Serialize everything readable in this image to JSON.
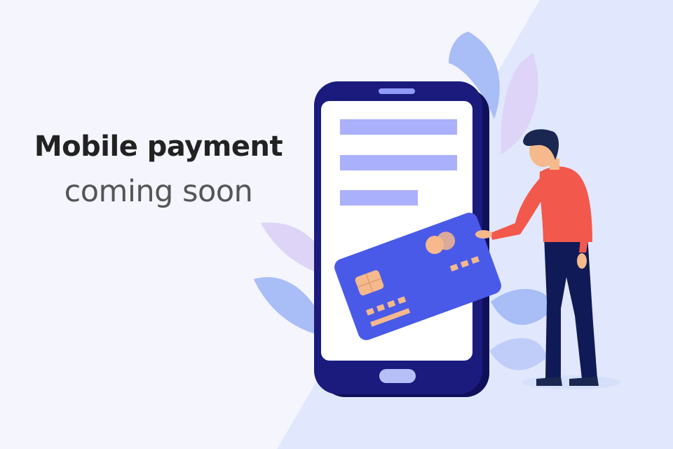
{
  "headline": {
    "title": "Mobile payment",
    "subtitle": "coming soon"
  },
  "colors": {
    "background": "#f4f5fd",
    "diagonal_panel": "#e1e8fd",
    "phone_body": "#1a1b7c",
    "phone_screen": "#ffffff",
    "screen_bars": "#aab0fb",
    "card": "#4a5ae8",
    "card_accent": "#f5b98c",
    "shirt": "#f2584c",
    "pants": "#101a56",
    "hair": "#1a2750",
    "skin": "#f5b98c",
    "leaf_blue": "#a9bdf7",
    "leaf_lilac": "#ddd4f7"
  },
  "illustration": {
    "icons": [
      "smartphone-icon",
      "credit-card-icon",
      "person-figure",
      "leaf-decoration"
    ]
  }
}
